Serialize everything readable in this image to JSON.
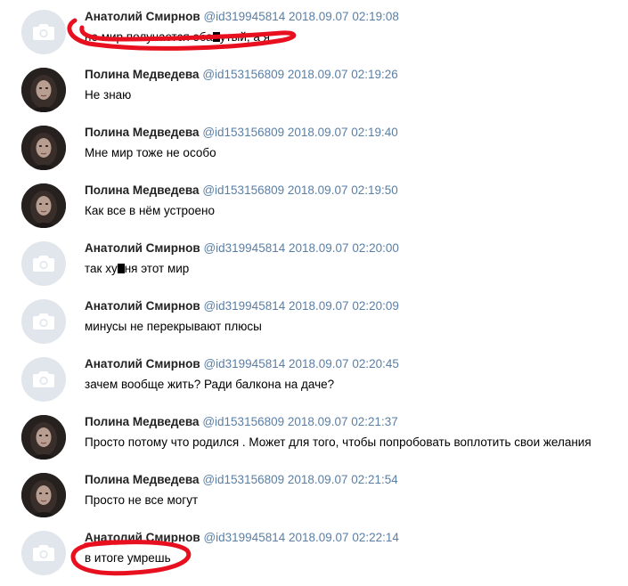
{
  "messages": [
    {
      "avatar": "camera-placeholder-icon",
      "name": "Анатолий Смирнов",
      "id": "@id319945814",
      "datetime": "2018.09.07 02:19:08",
      "text_a": "не мир получается еба",
      "text_b": "утый, а я"
    },
    {
      "avatar": "profile-photo",
      "name": "Полина Медведева",
      "id": "@id153156809",
      "datetime": "2018.09.07 02:19:26",
      "text": "Не знаю"
    },
    {
      "avatar": "profile-photo",
      "name": "Полина Медведева",
      "id": "@id153156809",
      "datetime": "2018.09.07 02:19:40",
      "text": "Мне мир тоже не особо"
    },
    {
      "avatar": "profile-photo",
      "name": "Полина Медведева",
      "id": "@id153156809",
      "datetime": "2018.09.07 02:19:50",
      "text": "Как все в нём устроено"
    },
    {
      "avatar": "camera-placeholder-icon",
      "name": "Анатолий Смирнов",
      "id": "@id319945814",
      "datetime": "2018.09.07 02:20:00",
      "text_a": "так ху",
      "text_b": "ня этот мир"
    },
    {
      "avatar": "camera-placeholder-icon",
      "name": "Анатолий Смирнов",
      "id": "@id319945814",
      "datetime": "2018.09.07 02:20:09",
      "text": "минусы не перекрывают плюсы"
    },
    {
      "avatar": "camera-placeholder-icon",
      "name": "Анатолий Смирнов",
      "id": "@id319945814",
      "datetime": "2018.09.07 02:20:45",
      "text": "зачем вообще жить? Ради балкона на даче?"
    },
    {
      "avatar": "profile-photo",
      "name": "Полина Медведева",
      "id": "@id153156809",
      "datetime": "2018.09.07 02:21:37",
      "text": "Просто потому что родился . Может для того, чтобы попробовать воплотить свои желания"
    },
    {
      "avatar": "profile-photo",
      "name": "Полина Медведева",
      "id": "@id153156809",
      "datetime": "2018.09.07 02:21:54",
      "text": "Просто не все могут"
    },
    {
      "avatar": "camera-placeholder-icon",
      "name": "Анатолий Смирнов",
      "id": "@id319945814",
      "datetime": "2018.09.07 02:22:14",
      "text": "в итоге умрешь"
    }
  ],
  "colors": {
    "name": "#222222",
    "meta": "#5a7fa6",
    "text": "#000000",
    "annotation": "#e8101e",
    "placeholder_bg": "#e1e6ec",
    "placeholder_icon": "#ffffff"
  }
}
